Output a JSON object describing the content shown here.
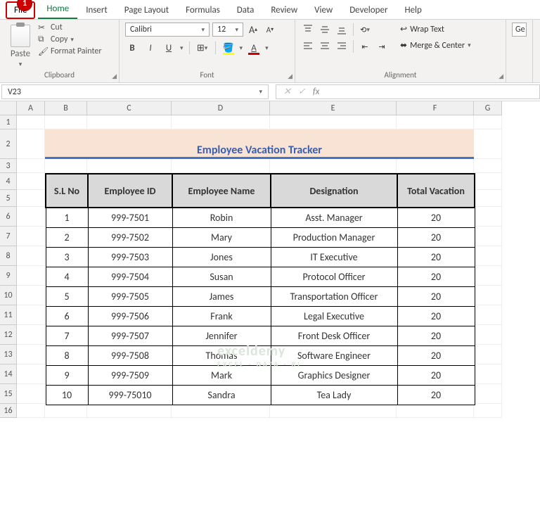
{
  "callout": "1",
  "tabs": [
    "File",
    "Home",
    "Insert",
    "Page Layout",
    "Formulas",
    "Data",
    "Review",
    "View",
    "Developer",
    "Help"
  ],
  "clipboard": {
    "paste": "Paste",
    "cut": "Cut",
    "copy": "Copy",
    "format_painter": "Format Painter",
    "title": "Clipboard"
  },
  "font": {
    "name": "Calibri",
    "size": "12",
    "bold": "B",
    "italic": "I",
    "underline": "U",
    "title": "Font",
    "grow": "A",
    "shrink": "A"
  },
  "alignment": {
    "wrap": "Wrap Text",
    "merge": "Merge & Center",
    "title": "Alignment"
  },
  "general_hint": "Ge",
  "name_box": "V23",
  "fx": "fx",
  "columns": [
    "A",
    "B",
    "C",
    "D",
    "E",
    "F",
    "G"
  ],
  "row_nums": [
    "1",
    "2",
    "3",
    "4",
    "5",
    "6",
    "7",
    "8",
    "9",
    "10",
    "11",
    "12",
    "13",
    "14",
    "15",
    "16"
  ],
  "title": "Employee Vacation Tracker",
  "headers": [
    "S.L No",
    "Employee ID",
    "Employee Name",
    "Designation",
    "Total Vacation"
  ],
  "rows": [
    [
      "1",
      "999-7501",
      "Robin",
      "Asst. Manager",
      "20"
    ],
    [
      "2",
      "999-7502",
      "Mary",
      "Production Manager",
      "20"
    ],
    [
      "3",
      "999-7503",
      "Jones",
      "IT Executive",
      "20"
    ],
    [
      "4",
      "999-7504",
      "Susan",
      "Protocol Officer",
      "20"
    ],
    [
      "5",
      "999-7505",
      "James",
      "Transportation Officer",
      "20"
    ],
    [
      "6",
      "999-7506",
      "Frank",
      "Legal Executive",
      "20"
    ],
    [
      "7",
      "999-7507",
      "Jennifer",
      "Front Desk Officer",
      "20"
    ],
    [
      "8",
      "999-7508",
      "Thomas",
      "Software Engineer",
      "20"
    ],
    [
      "9",
      "999-7509",
      "Mark",
      "Graphics Designer",
      "20"
    ],
    [
      "10",
      "999-75010",
      "Sandra",
      "Tea Lady",
      "20"
    ]
  ],
  "watermark": {
    "main": "exceldemy",
    "sub": "EXCEL · DATA · BI"
  },
  "col_widths": {
    "A": 40,
    "B": 60,
    "C": 120,
    "D": 140,
    "E": 180,
    "F": 110,
    "G": 40
  },
  "row_heights": {
    "1": 20,
    "2": 42,
    "3": 20,
    "4": 24,
    "5": 24,
    "6": 28,
    "7": 28,
    "8": 28,
    "9": 28,
    "10": 28,
    "11": 28,
    "12": 28,
    "13": 28,
    "14": 28,
    "15": 28,
    "16": 20
  }
}
